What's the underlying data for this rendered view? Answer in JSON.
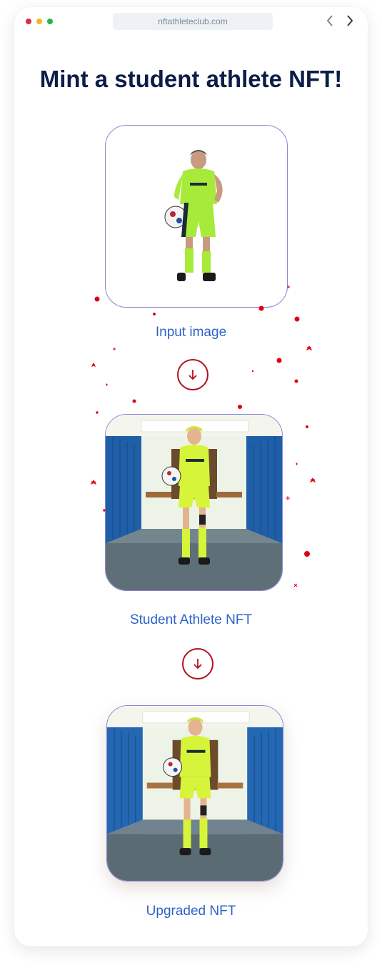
{
  "browser": {
    "url": "nftathleteclub.com",
    "traffic_lights": [
      "#e0283f",
      "#f1b526",
      "#27b24a"
    ]
  },
  "page": {
    "title": "Mint a student athlete NFT!"
  },
  "steps": [
    {
      "caption": "Input image"
    },
    {
      "caption": "Student Athlete NFT"
    },
    {
      "caption": "Upgraded NFT"
    }
  ],
  "colors": {
    "title": "#0c1d47",
    "caption": "#2d63c8",
    "arrow": "#b0121b",
    "card_border": "#8b86d6",
    "confetti": "#e00010"
  },
  "icons": {
    "arrow": "arrow-down-icon",
    "back": "chevron-left-icon",
    "forward": "chevron-right-icon"
  }
}
